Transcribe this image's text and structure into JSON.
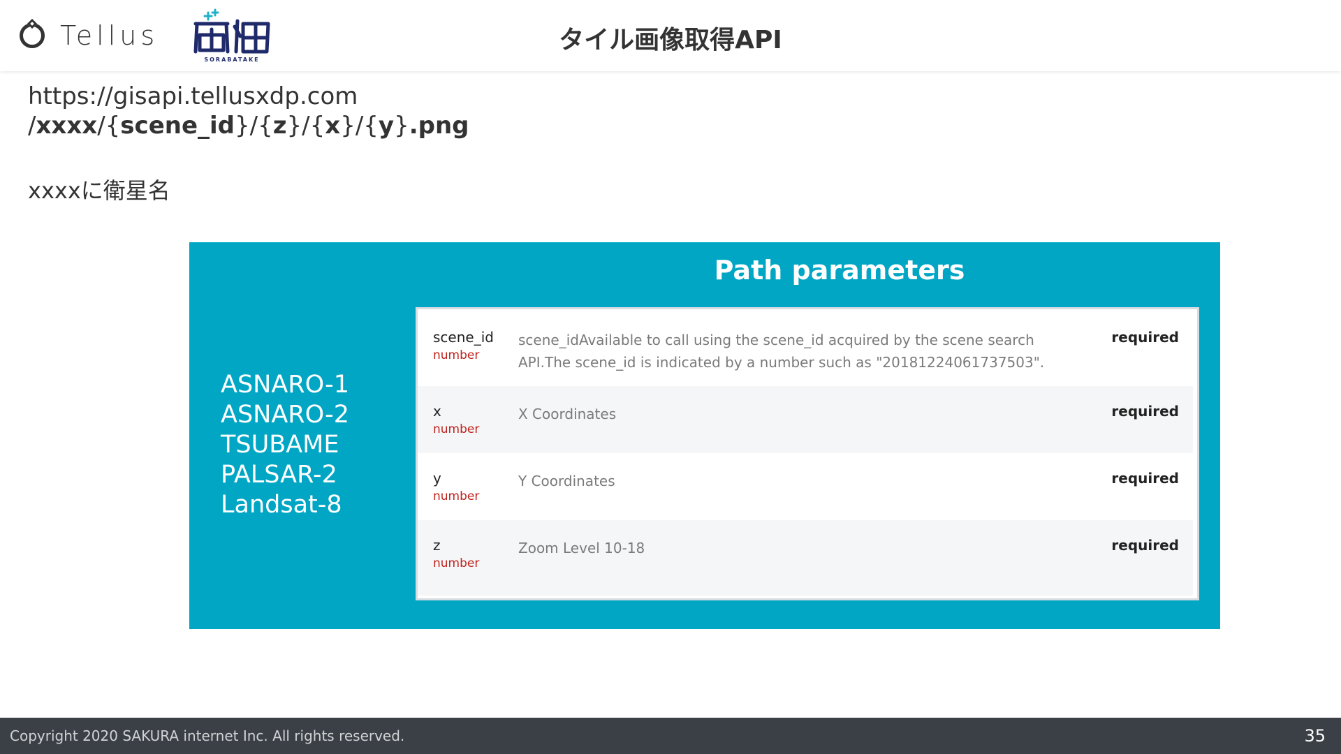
{
  "header": {
    "brand_text": "Tellus",
    "logo_sorabatake": "宙畑",
    "logo_sorabatake_sub": "SORABATAKE",
    "title": "タイル画像取得API"
  },
  "endpoint": {
    "base": "https://gisapi.tellusxdp.com",
    "path_parts": [
      {
        "text": "/",
        "bold": false
      },
      {
        "text": "xxxx",
        "bold": true
      },
      {
        "text": "/{",
        "bold": false
      },
      {
        "text": "scene_id",
        "bold": true
      },
      {
        "text": "}/{",
        "bold": false
      },
      {
        "text": "z",
        "bold": true
      },
      {
        "text": "}/{",
        "bold": false
      },
      {
        "text": "x",
        "bold": true
      },
      {
        "text": "}/{",
        "bold": false
      },
      {
        "text": "y",
        "bold": true
      },
      {
        "text": "}",
        "bold": false
      },
      {
        "text": ".png",
        "bold": true
      }
    ]
  },
  "note": "xxxxに衛星名",
  "panel": {
    "title": "Path parameters",
    "satellites": [
      "ASNARO-1",
      "ASNARO-2",
      "TSUBAME",
      "PALSAR-2",
      "Landsat-8"
    ],
    "params": [
      {
        "name": "scene_id",
        "type": "number",
        "desc": "scene_idAvailable to call using the scene_id acquired by the scene search API.The scene_id is indicated by a number such as \"20181224061737503\".",
        "required": "required"
      },
      {
        "name": "x",
        "type": "number",
        "desc": "X Coordinates",
        "required": "required"
      },
      {
        "name": "y",
        "type": "number",
        "desc": "Y Coordinates",
        "required": "required"
      },
      {
        "name": "z",
        "type": "number",
        "desc": "Zoom Level 10-18",
        "required": "required"
      }
    ]
  },
  "footer": {
    "copyright": "Copyright 2020 SAKURA internet Inc. All rights reserved.",
    "page_number": "35"
  },
  "colors": {
    "panel": "#00a6c4",
    "type_text": "#c0221c",
    "footer": "#3b4046",
    "logo_navy": "#1f2a6b"
  }
}
